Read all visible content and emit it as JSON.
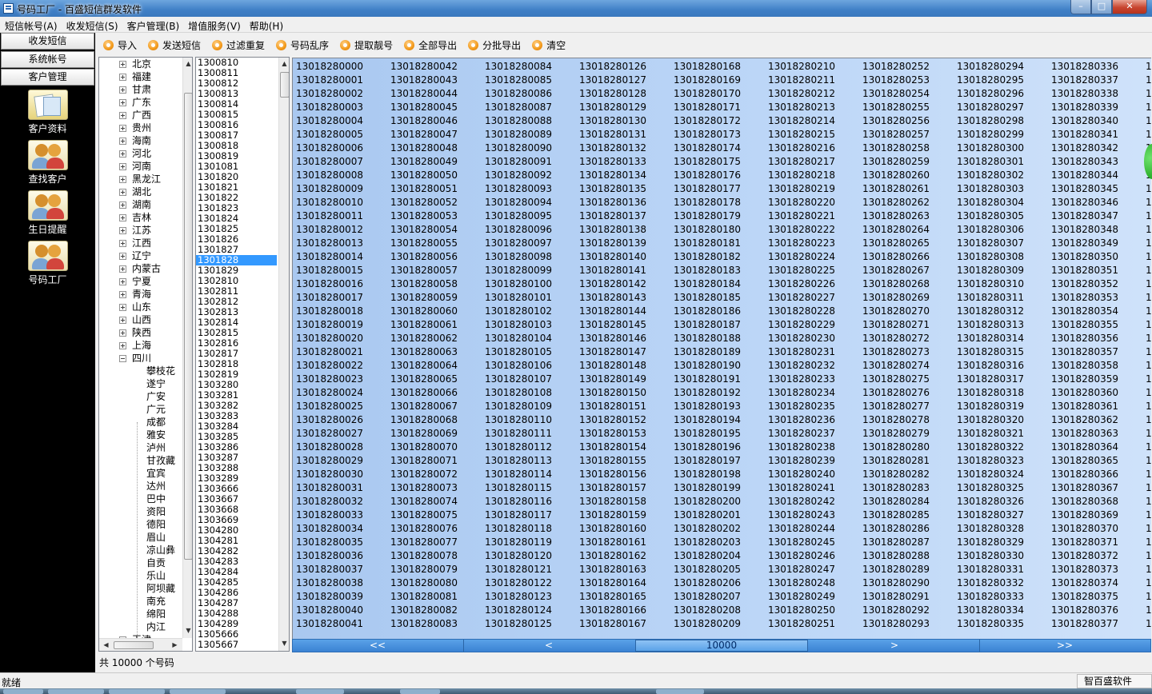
{
  "window": {
    "title": "号码工厂 - 百盛短信群发软件",
    "min": "–",
    "max": "□",
    "close": "✕"
  },
  "menu": [
    "短信帐号(A)",
    "收发短信(S)",
    "客户管理(B)",
    "增值服务(V)",
    "帮助(H)"
  ],
  "nav": {
    "tabs": [
      "收发短信",
      "系统帐号",
      "客户管理"
    ],
    "items": [
      {
        "label": "客户资料",
        "icon": "customer-card-icon"
      },
      {
        "label": "查找客户",
        "icon": "people-icon"
      },
      {
        "label": "生日提醒",
        "icon": "people-icon"
      },
      {
        "label": "号码工厂",
        "icon": "people-icon"
      }
    ]
  },
  "toolbar": [
    "导入",
    "发送短信",
    "过滤重复",
    "号码乱序",
    "提取靓号",
    "全部导出",
    "分批导出",
    "清空"
  ],
  "tree": {
    "provinces": [
      "北京",
      "福建",
      "甘肃",
      "广东",
      "广西",
      "贵州",
      "海南",
      "河北",
      "河南",
      "黑龙江",
      "湖北",
      "湖南",
      "吉林",
      "江苏",
      "江西",
      "辽宁",
      "内蒙古",
      "宁夏",
      "青海",
      "山东",
      "山西",
      "陕西",
      "上海",
      "四川"
    ],
    "cities": [
      "攀枝花",
      "遂宁",
      "广安",
      "广元",
      "成都",
      "雅安",
      "泸州",
      "甘孜藏",
      "宜宾",
      "达州",
      "巴中",
      "资阳",
      "德阳",
      "眉山",
      "凉山彝",
      "自贡",
      "乐山",
      "阿坝藏",
      "南充",
      "绵阳",
      "内江"
    ],
    "last_partial": "天津"
  },
  "prefixes": [
    "1300810",
    "1300811",
    "1300812",
    "1300813",
    "1300814",
    "1300815",
    "1300816",
    "1300817",
    "1300818",
    "1300819",
    "1301081",
    "1301820",
    "1301821",
    "1301822",
    "1301823",
    "1301824",
    "1301825",
    "1301826",
    "1301827",
    "1301828",
    "1301829",
    "1302810",
    "1302811",
    "1302812",
    "1302813",
    "1302814",
    "1302815",
    "1302816",
    "1302817",
    "1302818",
    "1302819",
    "1303280",
    "1303281",
    "1303282",
    "1303283",
    "1303284",
    "1303285",
    "1303286",
    "1303287",
    "1303288",
    "1303289",
    "1303666",
    "1303667",
    "1303668",
    "1303669",
    "1304280",
    "1304281",
    "1304282",
    "1304283",
    "1304284",
    "1304285",
    "1304286",
    "1304287",
    "1304288",
    "1304289",
    "1305666",
    "1305667"
  ],
  "selected_prefix": "1301828",
  "grid": {
    "base": 13018280000,
    "rows": 42,
    "cols": 9,
    "step_col": 42,
    "partial_col": "1"
  },
  "pager": {
    "first": "<<",
    "prev": "<",
    "page": "10000",
    "next": ">",
    "last": ">>"
  },
  "count_text": "共  10000  个号码",
  "status": {
    "text": "就绪",
    "brand": "智百盛软件"
  }
}
